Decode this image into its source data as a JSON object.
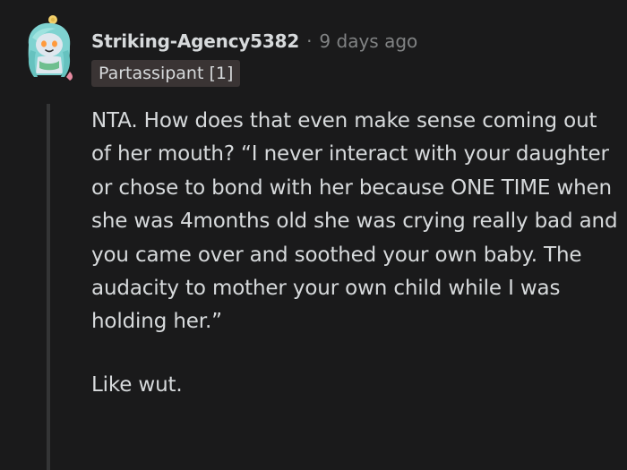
{
  "comment": {
    "username": "Striking-Agency5382",
    "separator": "·",
    "time_ago": "9 days ago",
    "flair": "Partassipant [1]",
    "paragraphs": [
      "NTA. How does that even make sense coming out of her mouth? “I never interact with your daughter or chose to bond with her because ONE TIME when she was 4months old she was crying really bad and you came over and soothed your own baby. The audacity to mother your own child while I was holding her.”",
      "Like wut."
    ]
  },
  "avatar": {
    "icon": "snoo-avatar-icon",
    "colors": {
      "hair": "#7fd3d1",
      "face": "#dfe7ee",
      "top_knot": "#f2d06b",
      "outfit": "#6fbf8f"
    }
  },
  "colors": {
    "background": "#1a1a1b",
    "text": "#d7dadc",
    "meta": "#818384",
    "flair_bg": "#3a3434",
    "thread_line": "#343536"
  }
}
